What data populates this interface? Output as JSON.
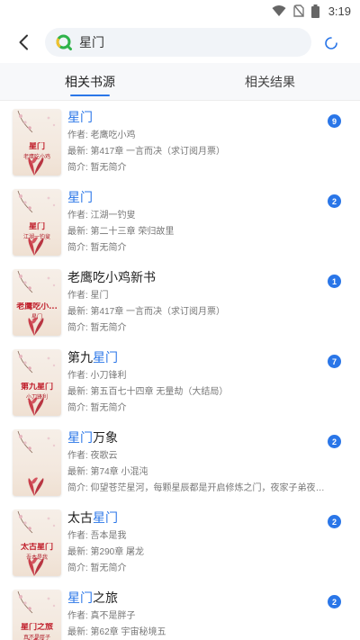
{
  "status_bar": {
    "time": "3:19"
  },
  "search": {
    "value": "星门",
    "placeholder": ""
  },
  "tabs": [
    {
      "label": "相关书源",
      "active": true
    },
    {
      "label": "相关结果",
      "active": false
    }
  ],
  "colors": {
    "accent": "#2a76e8",
    "badge": "#2a76e8",
    "cover_title": "#c01e2b"
  },
  "results": [
    {
      "title_parts": [
        {
          "text": "星门",
          "hl": true
        }
      ],
      "cover_title": "星门",
      "cover_author": "老鹰吃小鸡",
      "author": "作者: 老鹰吃小鸡",
      "latest": "最新: 第417章 一言而决（求订阅月票）",
      "intro": "简介: 暂无简介",
      "count": "9"
    },
    {
      "title_parts": [
        {
          "text": "星门",
          "hl": true
        }
      ],
      "cover_title": "星门",
      "cover_author": "江湖一钓叟",
      "author": "作者: 江湖一钓叟",
      "latest": "最新: 第二十三章 荣归故里",
      "intro": "简介: 暂无简介",
      "count": "2"
    },
    {
      "title_parts": [
        {
          "text": "老鹰吃小鸡新书",
          "hl": false
        }
      ],
      "cover_title": "老鹰吃小...",
      "cover_author": "星门",
      "author": "作者: 星门",
      "latest": "最新: 第417章 一言而决（求订阅月票）",
      "intro": "简介: 暂无简介",
      "count": "1"
    },
    {
      "title_parts": [
        {
          "text": "第九",
          "hl": false
        },
        {
          "text": "星门",
          "hl": true
        }
      ],
      "cover_title": "第九星门",
      "cover_author": "小刀锋利",
      "author": "作者: 小刀锋利",
      "latest": "最新: 第五百七十四章 无量劫（大结局）",
      "intro": "简介: 暂无简介",
      "count": "7"
    },
    {
      "title_parts": [
        {
          "text": "星门",
          "hl": true
        },
        {
          "text": "万象",
          "hl": false
        }
      ],
      "cover_title": "",
      "cover_author": "",
      "author": "作者: 夜歌云",
      "latest": "最新: 第74章 小混沌",
      "intro": "简介: 仰望苍茫星河，每颗星辰都是开启修炼之门，夜家子弟夜星辰，仰…",
      "count": "2"
    },
    {
      "title_parts": [
        {
          "text": "太古",
          "hl": false
        },
        {
          "text": "星门",
          "hl": true
        }
      ],
      "cover_title": "太古星门",
      "cover_author": "吾本是我",
      "author": "作者: 吾本是我",
      "latest": "最新: 第290章 屠龙",
      "intro": "简介: 暂无简介",
      "count": "2"
    },
    {
      "title_parts": [
        {
          "text": "星门",
          "hl": true
        },
        {
          "text": "之旅",
          "hl": false
        }
      ],
      "cover_title": "星门之旅",
      "cover_author": "真不是胖子",
      "author": "作者: 真不是胖子",
      "latest": "最新: 第62章 宇宙秘境五",
      "intro": "",
      "count": "2"
    }
  ]
}
